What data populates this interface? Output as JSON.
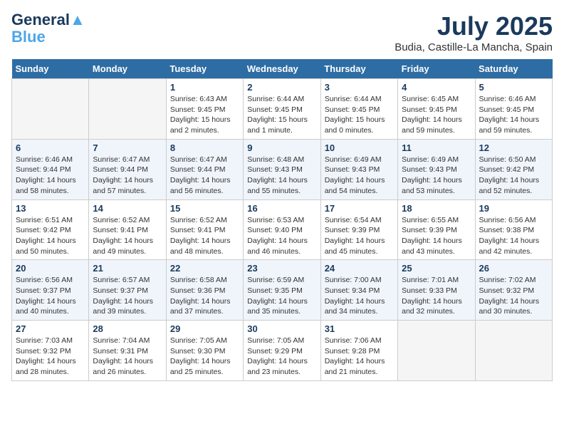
{
  "logo": {
    "line1": "General",
    "line2": "Blue"
  },
  "title": "July 2025",
  "subtitle": "Budia, Castille-La Mancha, Spain",
  "weekdays": [
    "Sunday",
    "Monday",
    "Tuesday",
    "Wednesday",
    "Thursday",
    "Friday",
    "Saturday"
  ],
  "weeks": [
    [
      {
        "day": "",
        "info": ""
      },
      {
        "day": "",
        "info": ""
      },
      {
        "day": "1",
        "info": "Sunrise: 6:43 AM\nSunset: 9:45 PM\nDaylight: 15 hours\nand 2 minutes."
      },
      {
        "day": "2",
        "info": "Sunrise: 6:44 AM\nSunset: 9:45 PM\nDaylight: 15 hours\nand 1 minute."
      },
      {
        "day": "3",
        "info": "Sunrise: 6:44 AM\nSunset: 9:45 PM\nDaylight: 15 hours\nand 0 minutes."
      },
      {
        "day": "4",
        "info": "Sunrise: 6:45 AM\nSunset: 9:45 PM\nDaylight: 14 hours\nand 59 minutes."
      },
      {
        "day": "5",
        "info": "Sunrise: 6:46 AM\nSunset: 9:45 PM\nDaylight: 14 hours\nand 59 minutes."
      }
    ],
    [
      {
        "day": "6",
        "info": "Sunrise: 6:46 AM\nSunset: 9:44 PM\nDaylight: 14 hours\nand 58 minutes."
      },
      {
        "day": "7",
        "info": "Sunrise: 6:47 AM\nSunset: 9:44 PM\nDaylight: 14 hours\nand 57 minutes."
      },
      {
        "day": "8",
        "info": "Sunrise: 6:47 AM\nSunset: 9:44 PM\nDaylight: 14 hours\nand 56 minutes."
      },
      {
        "day": "9",
        "info": "Sunrise: 6:48 AM\nSunset: 9:43 PM\nDaylight: 14 hours\nand 55 minutes."
      },
      {
        "day": "10",
        "info": "Sunrise: 6:49 AM\nSunset: 9:43 PM\nDaylight: 14 hours\nand 54 minutes."
      },
      {
        "day": "11",
        "info": "Sunrise: 6:49 AM\nSunset: 9:43 PM\nDaylight: 14 hours\nand 53 minutes."
      },
      {
        "day": "12",
        "info": "Sunrise: 6:50 AM\nSunset: 9:42 PM\nDaylight: 14 hours\nand 52 minutes."
      }
    ],
    [
      {
        "day": "13",
        "info": "Sunrise: 6:51 AM\nSunset: 9:42 PM\nDaylight: 14 hours\nand 50 minutes."
      },
      {
        "day": "14",
        "info": "Sunrise: 6:52 AM\nSunset: 9:41 PM\nDaylight: 14 hours\nand 49 minutes."
      },
      {
        "day": "15",
        "info": "Sunrise: 6:52 AM\nSunset: 9:41 PM\nDaylight: 14 hours\nand 48 minutes."
      },
      {
        "day": "16",
        "info": "Sunrise: 6:53 AM\nSunset: 9:40 PM\nDaylight: 14 hours\nand 46 minutes."
      },
      {
        "day": "17",
        "info": "Sunrise: 6:54 AM\nSunset: 9:39 PM\nDaylight: 14 hours\nand 45 minutes."
      },
      {
        "day": "18",
        "info": "Sunrise: 6:55 AM\nSunset: 9:39 PM\nDaylight: 14 hours\nand 43 minutes."
      },
      {
        "day": "19",
        "info": "Sunrise: 6:56 AM\nSunset: 9:38 PM\nDaylight: 14 hours\nand 42 minutes."
      }
    ],
    [
      {
        "day": "20",
        "info": "Sunrise: 6:56 AM\nSunset: 9:37 PM\nDaylight: 14 hours\nand 40 minutes."
      },
      {
        "day": "21",
        "info": "Sunrise: 6:57 AM\nSunset: 9:37 PM\nDaylight: 14 hours\nand 39 minutes."
      },
      {
        "day": "22",
        "info": "Sunrise: 6:58 AM\nSunset: 9:36 PM\nDaylight: 14 hours\nand 37 minutes."
      },
      {
        "day": "23",
        "info": "Sunrise: 6:59 AM\nSunset: 9:35 PM\nDaylight: 14 hours\nand 35 minutes."
      },
      {
        "day": "24",
        "info": "Sunrise: 7:00 AM\nSunset: 9:34 PM\nDaylight: 14 hours\nand 34 minutes."
      },
      {
        "day": "25",
        "info": "Sunrise: 7:01 AM\nSunset: 9:33 PM\nDaylight: 14 hours\nand 32 minutes."
      },
      {
        "day": "26",
        "info": "Sunrise: 7:02 AM\nSunset: 9:32 PM\nDaylight: 14 hours\nand 30 minutes."
      }
    ],
    [
      {
        "day": "27",
        "info": "Sunrise: 7:03 AM\nSunset: 9:32 PM\nDaylight: 14 hours\nand 28 minutes."
      },
      {
        "day": "28",
        "info": "Sunrise: 7:04 AM\nSunset: 9:31 PM\nDaylight: 14 hours\nand 26 minutes."
      },
      {
        "day": "29",
        "info": "Sunrise: 7:05 AM\nSunset: 9:30 PM\nDaylight: 14 hours\nand 25 minutes."
      },
      {
        "day": "30",
        "info": "Sunrise: 7:05 AM\nSunset: 9:29 PM\nDaylight: 14 hours\nand 23 minutes."
      },
      {
        "day": "31",
        "info": "Sunrise: 7:06 AM\nSunset: 9:28 PM\nDaylight: 14 hours\nand 21 minutes."
      },
      {
        "day": "",
        "info": ""
      },
      {
        "day": "",
        "info": ""
      }
    ]
  ]
}
